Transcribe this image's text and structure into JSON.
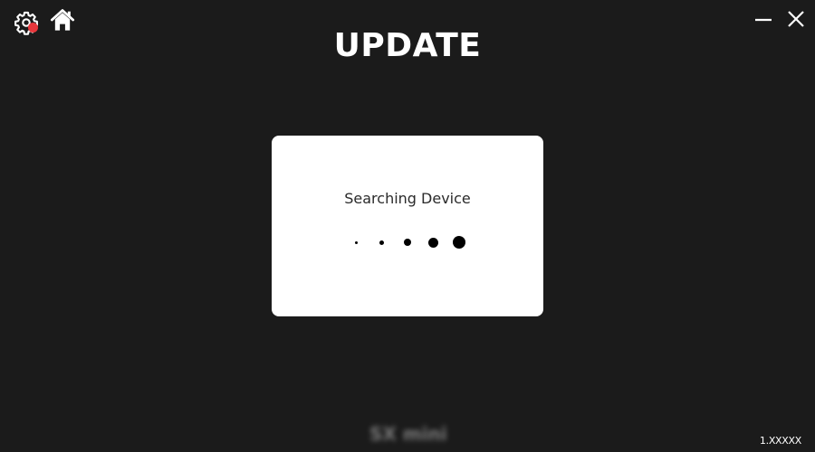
{
  "header": {
    "title": "UPDATE",
    "settings_icon": "gear-icon",
    "settings_badge_color": "#e8373c",
    "home_icon": "home-icon",
    "minimize_icon": "minimize-icon",
    "close_icon": "close-icon"
  },
  "dialog": {
    "message": "Searching Device",
    "loader_icon": "loading-dots-icon"
  },
  "footer": {
    "brand_logo": "SX mini",
    "version": "1.XXXXX"
  },
  "colors": {
    "background": "#1b1b1b",
    "dialog_background": "#ffffff",
    "accent": "#e8373c"
  }
}
